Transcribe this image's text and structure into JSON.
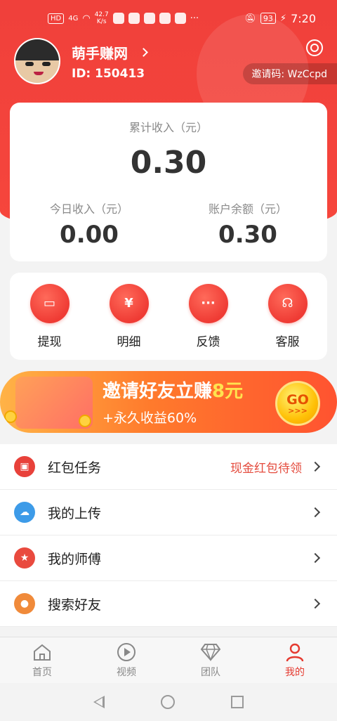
{
  "status_bar": {
    "net_left": "HD",
    "signal": "4G",
    "speed": "42.7\nK/s",
    "more": "···",
    "battery": "93",
    "time": "7:20"
  },
  "profile": {
    "name": "萌手赚网",
    "id": "ID: 150413",
    "invite_code": "邀请码: WzCcpd"
  },
  "income": {
    "total_label": "累计收入（元）",
    "total_value": "0.30",
    "today_label": "今日收入（元）",
    "today_value": "0.00",
    "balance_label": "账户余额（元）",
    "balance_value": "0.30"
  },
  "actions": [
    {
      "label": "提现",
      "icon": "wallet-icon"
    },
    {
      "label": "明细",
      "icon": "calendar-yen-icon"
    },
    {
      "label": "反馈",
      "icon": "chat-bubble-icon"
    },
    {
      "label": "客服",
      "icon": "headset-icon"
    }
  ],
  "banner": {
    "title_prefix": "邀请好友立赚",
    "title_highlight": "8元",
    "subtitle": "+永久收益60%",
    "go": "GO",
    "go_arrows": ">>>"
  },
  "menu": [
    {
      "label": "红包任务",
      "hint": "现金红包待领",
      "icon": "red-packet-icon",
      "color": "#e8413a"
    },
    {
      "label": "我的上传",
      "hint": "",
      "icon": "cloud-upload-icon",
      "color": "#3d9be8"
    },
    {
      "label": "我的师傅",
      "hint": "",
      "icon": "star-icon",
      "color": "#e94a3e"
    },
    {
      "label": "搜索好友",
      "hint": "",
      "icon": "user-icon",
      "color": "#f08a3a"
    }
  ],
  "tabbar": [
    {
      "label": "首页",
      "icon": "home-icon",
      "active": false
    },
    {
      "label": "视频",
      "icon": "play-icon",
      "active": false
    },
    {
      "label": "团队",
      "icon": "diamond-icon",
      "active": false
    },
    {
      "label": "我的",
      "icon": "person-icon",
      "active": true
    }
  ],
  "colors": {
    "brand_red": "#f0403b",
    "active_tab": "#e53a30",
    "hint_red": "#e44b3d"
  }
}
